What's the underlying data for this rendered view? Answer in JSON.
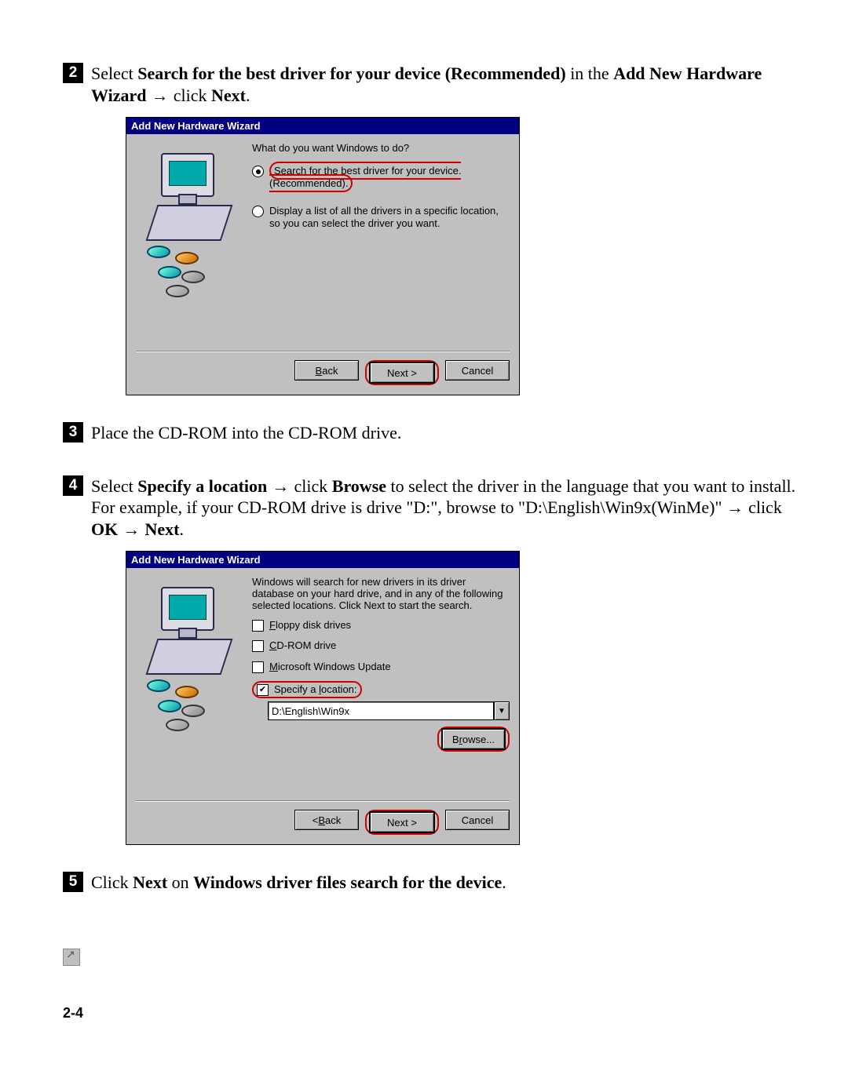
{
  "page_number": "2-4",
  "steps": {
    "s2": {
      "num": "2",
      "pre": "Select ",
      "bold1": "Search for the best driver for your device (Recommended)",
      "mid1": " in the ",
      "bold2": "Add New Hardware Wizard",
      "arrow": " → ",
      "mid2": "click ",
      "bold3": "Next",
      "end": "."
    },
    "s3": {
      "num": "3",
      "text": "Place the CD-ROM into the CD-ROM drive."
    },
    "s4": {
      "num": "4",
      "pre": "Select ",
      "bold1": "Specify a location",
      "arrow1": " → ",
      "mid1": "click ",
      "bold2": "Browse",
      "mid2": " to select the driver in the language that you want to install. For example, if your CD-ROM drive is drive \"D:\", browse to \"D:\\English\\Win9x(WinMe)\" ",
      "arrow2": "→ ",
      "mid3": "click ",
      "bold3": "OK",
      "arrow3": " → ",
      "bold4": "Next",
      "end": "."
    },
    "s5": {
      "num": "5",
      "pre": "Click ",
      "bold1": "Next",
      "mid": " on ",
      "bold2": "Windows driver files search for the device",
      "end": "."
    }
  },
  "dlg1": {
    "title": "Add New Hardware Wizard",
    "question": "What do you want Windows to do?",
    "opt1a": "Search for the best driver for your device.",
    "opt1b": "(Recommended).",
    "opt2": "Display a list of all the drivers in a specific location, so you can select the driver you want.",
    "back": "< Back",
    "next": "Next >",
    "cancel": "Cancel"
  },
  "dlg2": {
    "title": "Add New Hardware Wizard",
    "intro": "Windows will search for new drivers in its driver database on your hard drive, and in any of the following selected locations. Click Next to start the search.",
    "c1": "Floppy disk drives",
    "c2": "CD-ROM drive",
    "c3": "Microsoft Windows Update",
    "c4": "Specify a location:",
    "path": "D:\\English\\Win9x",
    "browse": "Browse...",
    "back": "< Back",
    "next": "Next >",
    "cancel": "Cancel"
  }
}
